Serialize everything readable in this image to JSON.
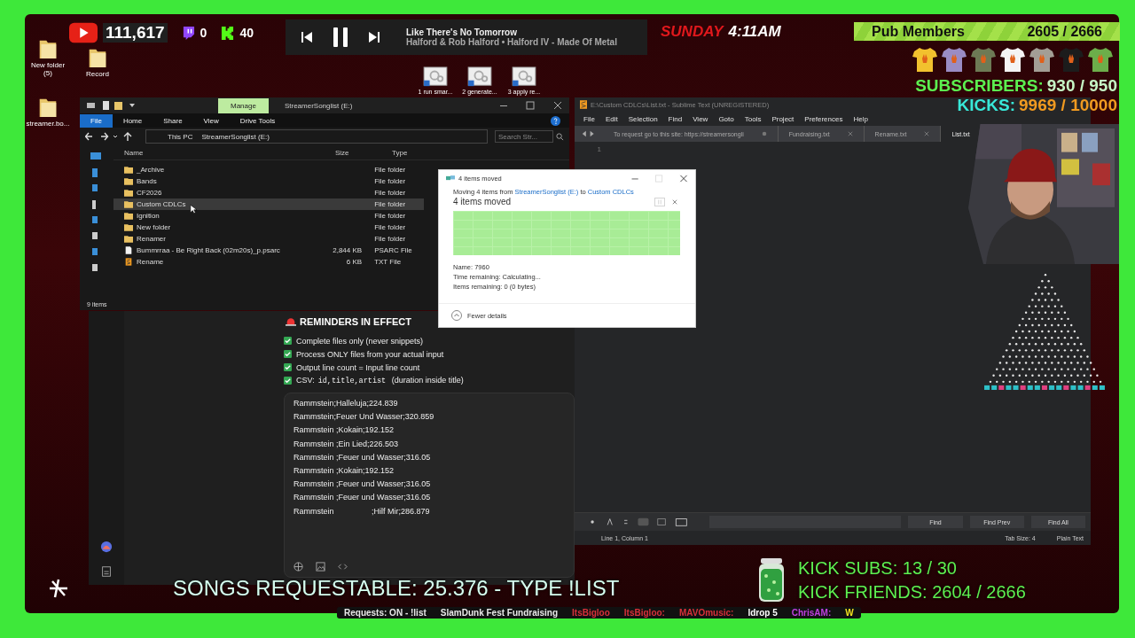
{
  "stats": {
    "youtube": "111,617",
    "twitch": "0",
    "kick": "40"
  },
  "player": {
    "title": "Like There's No Tomorrow",
    "subtitle": "Halford & Rob Halford • Halford IV - Made Of Metal",
    "playing": true
  },
  "clock": {
    "day": "SUNDAY",
    "time": "4:11AM"
  },
  "pub": {
    "label": "Pub Members",
    "count": "2605 / 2666"
  },
  "subscribers": {
    "label": "SUBSCRIBERS:",
    "value": "930 / 950"
  },
  "kicks": {
    "label": "KICKS:",
    "value": "9969 / 10000"
  },
  "desktop_icons": [
    {
      "label": "New folder (5)",
      "kind": "folder"
    },
    {
      "label": "Record",
      "kind": "folder"
    },
    {
      "label": "streamer.bo...",
      "kind": "folder"
    }
  ],
  "shortcuts": [
    {
      "label": "1 run smar..."
    },
    {
      "label": "2 generate..."
    },
    {
      "label": "3 apply re..."
    }
  ],
  "explorer": {
    "ribbon_context": "Manage",
    "title": "StreamerSonglist (E:)",
    "tabs": [
      {
        "label": "File",
        "selected": true
      },
      {
        "label": "Home",
        "selected": false
      },
      {
        "label": "Share",
        "selected": false
      },
      {
        "label": "View",
        "selected": false
      },
      {
        "label": "Drive Tools",
        "selected": false
      }
    ],
    "path": [
      "This PC",
      "StreamerSonglist (E:)"
    ],
    "search": {
      "placeholder": "Search Str..."
    },
    "columns": [
      "Name",
      "Size",
      "Type"
    ],
    "rows": [
      {
        "name": "_Archive",
        "size": "",
        "type": "File folder",
        "kind": "folder",
        "selected": false
      },
      {
        "name": "Bands",
        "size": "",
        "type": "File folder",
        "kind": "folder",
        "selected": false
      },
      {
        "name": "CF2026",
        "size": "",
        "type": "File folder",
        "kind": "folder",
        "selected": false
      },
      {
        "name": "Custom CDLCs",
        "size": "",
        "type": "File folder",
        "kind": "folder",
        "selected": true
      },
      {
        "name": "Ignition",
        "size": "",
        "type": "File folder",
        "kind": "folder",
        "selected": false
      },
      {
        "name": "New folder",
        "size": "",
        "type": "File folder",
        "kind": "folder",
        "selected": false
      },
      {
        "name": "Renamer",
        "size": "",
        "type": "File folder",
        "kind": "folder",
        "selected": false
      },
      {
        "name": "Bummrraa - Be Right Back (02m20s)_p.psarc",
        "size": "2,844 KB",
        "type": "PSARC File",
        "kind": "file",
        "selected": false
      },
      {
        "name": "Rename",
        "size": "6 KB",
        "type": "TXT File",
        "kind": "text",
        "selected": false
      }
    ],
    "status": "9 items"
  },
  "copy_dialog": {
    "title": "4 items moved",
    "moving": "Moving 4 items from",
    "source": "StreamerSonglist (E:)",
    "to": "to",
    "target": "Custom CDLCs",
    "heading": "4 items moved",
    "level": 1,
    "details": [
      "Name: 7960",
      "Time remaining: Calculating...",
      "Items remaining: 0 (0 bytes)"
    ],
    "toggle": "Fewer details"
  },
  "sublime": {
    "title": "E:\\Custom CDLCs\\List.txt - Sublime Text (UNREGISTERED)",
    "menu": [
      "File",
      "Edit",
      "Selection",
      "Find",
      "View",
      "Goto",
      "Tools",
      "Project",
      "Preferences",
      "Help"
    ],
    "tabs": [
      {
        "label": "To request go to this site: https://streamersongli",
        "selected": false,
        "modified": true
      },
      {
        "label": "Fundraising.txt",
        "selected": false,
        "modified": false
      },
      {
        "label": "Rename.txt",
        "selected": false,
        "modified": false
      },
      {
        "label": "List.txt",
        "selected": true,
        "modified": false
      }
    ],
    "line_number": "1",
    "find_buttons": [
      "Find",
      "Find Prev",
      "Find All"
    ],
    "status": "Line 1, Column 1",
    "tab_size": "Tab Size: 4",
    "syntax": "Plain Text"
  },
  "chat": {
    "heading": "REMINDERS IN EFFECT",
    "reminders": [
      {
        "text": "Complete files only (never snippets)",
        "checked": true
      },
      {
        "text": "Process ONLY files from your actual input",
        "checked": true
      },
      {
        "text": "Output line count = Input line count",
        "checked": true
      },
      {
        "text": "CSV:",
        "code": "id,title,artist",
        "note": "(duration inside title)",
        "checked": true
      }
    ],
    "lines": [
      "Rammstein;Halleluja;224.839",
      "Rammstein;Feuer Und Wasser;320.859",
      "Rammstein ;Kokain;192.152",
      "Rammstein ;Ein Lied;226.503",
      "Rammstein ;Feuer und Wasser;316.05",
      "Rammstein ;Kokain;192.152",
      "Rammstein ;Feuer und Wasser;316.05",
      "Rammstein ;Feuer und Wasser;316.05",
      "Rammstein                 ;Hilf Mir;286.879"
    ]
  },
  "songs_banner": "SONGS REQUESTABLE: 25.376 - TYPE !LIST",
  "kick_subs": "KICK SUBS: 13 / 30",
  "kick_friends": "KICK FRIENDS: 2604 / 2666",
  "ticker": [
    {
      "text": "Requests: ON - !list",
      "color": "#e8e8e8"
    },
    {
      "text": "SlamDunk Fest Fundraising",
      "color": "#e8e8e8"
    },
    {
      "text": "ItsBigloo",
      "color": "#d8313a"
    },
    {
      "text": "ItsBigloo:",
      "color": "#d8313a"
    },
    {
      "text": "MAVOmusic:",
      "color": "#d8313a"
    },
    {
      "text": "ldrop 5",
      "color": "#ffffff"
    },
    {
      "text": "ChrisAM:",
      "color": "#c040e0"
    },
    {
      "text": "W",
      "color": "#f0e020"
    }
  ]
}
